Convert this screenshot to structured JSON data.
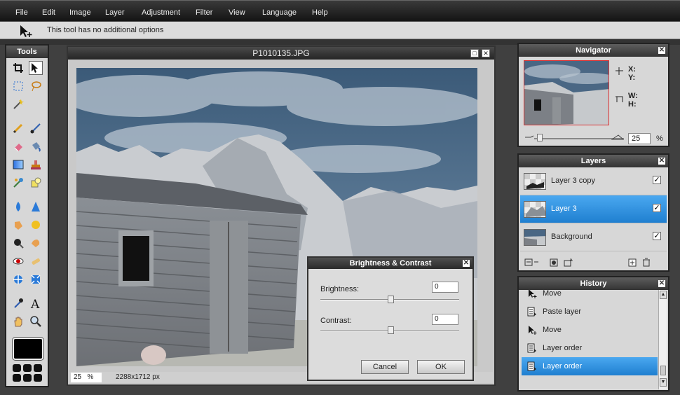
{
  "menu": [
    "File",
    "Edit",
    "Image",
    "Layer",
    "Adjustment",
    "Filter",
    "View",
    "Language",
    "Help"
  ],
  "options_bar": {
    "text": "This tool has no additional options"
  },
  "tools": {
    "title": "Tools"
  },
  "image_window": {
    "title": "P1010135.JPG",
    "zoom_value": "25",
    "zoom_unit": "%",
    "dimensions": "2288x1712 px"
  },
  "dialog": {
    "title": "Brightness & Contrast",
    "brightness_label": "Brightness:",
    "brightness_value": "0",
    "contrast_label": "Contrast:",
    "contrast_value": "0",
    "cancel_label": "Cancel",
    "ok_label": "OK"
  },
  "navigator": {
    "title": "Navigator",
    "x_label": "X:",
    "y_label": "Y:",
    "w_label": "W:",
    "h_label": "H:",
    "zoom_value": "25",
    "zoom_unit": "%"
  },
  "layers": {
    "title": "Layers",
    "items": [
      {
        "name": "Layer 3 copy",
        "visible": true,
        "selected": false
      },
      {
        "name": "Layer 3",
        "visible": true,
        "selected": true
      },
      {
        "name": "Background",
        "visible": true,
        "selected": false
      }
    ]
  },
  "history": {
    "title": "History",
    "items": [
      {
        "name": "Move",
        "icon": "move-icon"
      },
      {
        "name": "Paste layer",
        "icon": "layer-doc-icon"
      },
      {
        "name": "Move",
        "icon": "move-icon"
      },
      {
        "name": "Layer order",
        "icon": "layer-doc-icon"
      },
      {
        "name": "Layer order",
        "icon": "layer-doc-icon",
        "selected": true
      }
    ]
  },
  "colors": {
    "selection": "#1f7fd0",
    "primary_color": "#000000"
  }
}
